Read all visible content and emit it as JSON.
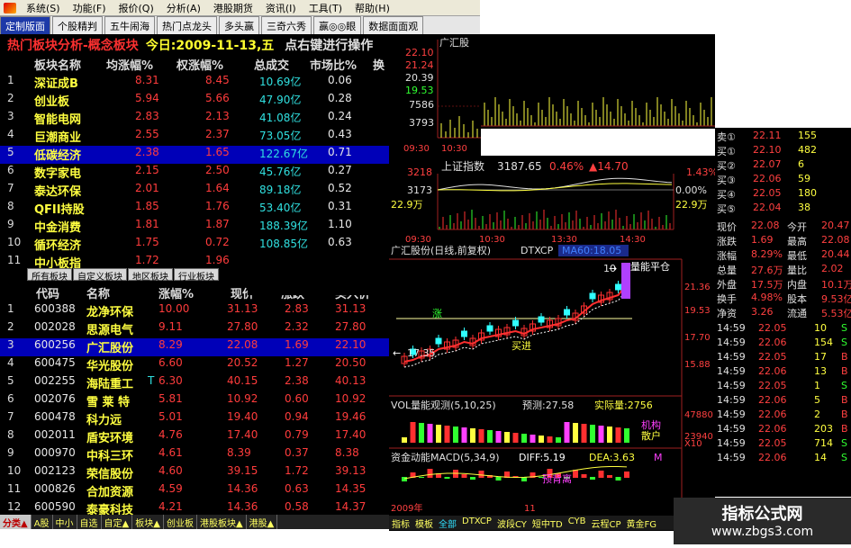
{
  "menubar": {
    "items": [
      "系统(S)",
      "功能(F)",
      "报价(Q)",
      "分析(A)",
      "港股期货",
      "资讯(I)",
      "工具(T)",
      "帮助(H)"
    ]
  },
  "tabs": {
    "items": [
      "定制版面",
      "个股精判",
      "五牛闹海",
      "热门点龙头",
      "多头赢",
      "三奇六秀",
      "赢◎◎眼",
      "数据面面观"
    ]
  },
  "top_panel": {
    "title": "热门板块分析-概念板块",
    "date": "今日:2009-11-13,五",
    "hint": "点右键进行操作",
    "headers": [
      "板块名称",
      "均涨幅%",
      "权涨幅%",
      "总成交",
      "市场比%",
      "换"
    ],
    "rows": [
      {
        "idx": "1",
        "name": "深证成B",
        "avg": "8.31",
        "wavg": "8.45",
        "vol": "10.69亿",
        "ratio": "0.06"
      },
      {
        "idx": "2",
        "name": "创业板",
        "avg": "5.94",
        "wavg": "5.66",
        "vol": "47.90亿",
        "ratio": "0.28"
      },
      {
        "idx": "3",
        "name": "智能电网",
        "avg": "2.83",
        "wavg": "2.13",
        "vol": "41.08亿",
        "ratio": "0.24"
      },
      {
        "idx": "4",
        "name": "巨潮商业",
        "avg": "2.55",
        "avg2": "",
        "wavg": "2.37",
        "vol": "73.05亿",
        "ratio": "0.43"
      },
      {
        "idx": "5",
        "name": "低碳经济",
        "avg": "2.38",
        "wavg": "1.65",
        "vol": "122.67亿",
        "ratio": "0.71"
      },
      {
        "idx": "6",
        "name": "数字家电",
        "avg": "2.15",
        "wavg": "2.50",
        "vol": "45.76亿",
        "ratio": "0.27"
      },
      {
        "idx": "7",
        "name": "泰达环保",
        "avg": "2.01",
        "wavg": "1.64",
        "vol": "89.18亿",
        "ratio": "0.52"
      },
      {
        "idx": "8",
        "name": "QFII持股",
        "avg": "1.85",
        "wavg": "1.76",
        "vol": "53.40亿",
        "ratio": "0.31"
      },
      {
        "idx": "9",
        "name": "中金消费",
        "avg": "1.81",
        "wavg": "1.87",
        "vol": "188.39亿",
        "ratio": "1.10"
      },
      {
        "idx": "10",
        "name": "循环经济",
        "avg": "1.75",
        "wavg": "0.72",
        "vol": "108.85亿",
        "ratio": "0.63"
      },
      {
        "idx": "11",
        "name": "中小板指",
        "avg": "1.72",
        "wavg": "1.96",
        "vol": "",
        "ratio": ""
      }
    ],
    "subtabs": [
      "所有板块",
      "自定义板块",
      "地区板块",
      "行业板块"
    ]
  },
  "bottom_panel": {
    "headers": [
      "代码",
      "名称",
      "涨幅%",
      "现价",
      "涨跌",
      "买入价"
    ],
    "rows": [
      {
        "idx": "1",
        "code": "600388",
        "name": "龙净环保",
        "chg": "10.00",
        "price": "31.13",
        "diff": "2.83",
        "buy": "31.13"
      },
      {
        "idx": "2",
        "code": "002028",
        "name": "思源电气",
        "chg": "9.11",
        "price": "27.80",
        "diff": "2.32",
        "buy": "27.80"
      },
      {
        "idx": "3",
        "code": "600256",
        "name": "广汇股份",
        "chg": "8.29",
        "price": "22.08",
        "diff": "1.69",
        "buy": "22.10"
      },
      {
        "idx": "4",
        "code": "600475",
        "name": "华光股份",
        "chg": "6.60",
        "price": "20.52",
        "diff": "1.27",
        "buy": "20.50"
      },
      {
        "idx": "5",
        "code": "002255",
        "name": "海陆重工",
        "mark": "T",
        "chg": "6.30",
        "price": "40.15",
        "diff": "2.38",
        "buy": "40.13"
      },
      {
        "idx": "6",
        "code": "002076",
        "name": "雪 莱 特",
        "chg": "5.81",
        "price": "10.92",
        "diff": "0.60",
        "buy": "10.92"
      },
      {
        "idx": "7",
        "code": "600478",
        "name": "科力远",
        "chg": "5.01",
        "price": "19.40",
        "diff": "0.94",
        "buy": "19.46"
      },
      {
        "idx": "8",
        "code": "002011",
        "name": "盾安环境",
        "chg": "4.76",
        "price": "17.40",
        "diff": "0.79",
        "buy": "17.40"
      },
      {
        "idx": "9",
        "code": "000970",
        "name": "中科三环",
        "chg": "4.61",
        "price": "8.39",
        "diff": "0.37",
        "buy": "8.38"
      },
      {
        "idx": "10",
        "code": "002123",
        "name": "荣信股份",
        "chg": "4.60",
        "price": "39.15",
        "diff": "1.72",
        "buy": "39.13"
      },
      {
        "idx": "11",
        "code": "000826",
        "name": "合加资源",
        "chg": "4.59",
        "price": "14.36",
        "diff": "0.63",
        "buy": "14.35"
      },
      {
        "idx": "12",
        "code": "600590",
        "name": "泰豪科技",
        "chg": "4.21",
        "price": "14.36",
        "diff": "0.58",
        "buy": "14.37"
      }
    ],
    "tabs": [
      "分类▲",
      "A股",
      "中小",
      "自选",
      "自定▲",
      "板块▲",
      "创业板",
      "港股板块▲",
      "港股▲"
    ]
  },
  "intraday": {
    "name": "广汇股",
    "yticks": [
      "22.10",
      "21.24",
      "20.39",
      "19.53"
    ],
    "vticks": [
      "7586",
      "3793"
    ],
    "times": [
      "09:30",
      "10:30",
      "13:30",
      "14:30"
    ]
  },
  "index_panel": {
    "name": "上证指数",
    "value": "3187.65",
    "pct": "0.46%",
    "chg": "▲14.70",
    "left_ticks": [
      "3218",
      "3173",
      "22.9万"
    ],
    "right_ticks": [
      "1.43%",
      "0.00%",
      "22.9万"
    ],
    "times": [
      "09:30",
      "10:30",
      "13:30",
      "14:30"
    ]
  },
  "kline": {
    "title": "广汇股份(日线,前复权)",
    "indicator": "DTXCP",
    "ma": "MA60:18.05",
    "ticks": [
      "22.10",
      "21.36",
      "19.53",
      "17.70",
      "15.88"
    ],
    "annot_low": "17.35",
    "annot_high": "10",
    "annot_buy": "买进",
    "annot_level": "量能平仓",
    "vol_title": "VOL量能观测(5,10,25)",
    "vol_pred": "预测:27.58",
    "vol_actual": "实际量:2756",
    "vol_ticks": [
      "47880",
      "23940"
    ],
    "vol_note1": "机构",
    "vol_note2": "散户",
    "vol_x": "X10",
    "macd_title": "资金动能MACD(5,34,9)",
    "macd_diff": "DIFF:5.19",
    "macd_dea": "DEA:3.63",
    "macd_m": "M",
    "macd_note": "预背离",
    "year": "2009年",
    "month": "11"
  },
  "order_book": {
    "rows": [
      {
        "label": "卖①",
        "price": "22.11",
        "vol": "155"
      },
      {
        "label": "买①",
        "price": "22.10",
        "vol": "482"
      },
      {
        "label": "买②",
        "price": "22.07",
        "vol": "6"
      },
      {
        "label": "买③",
        "price": "22.06",
        "vol": "59"
      },
      {
        "label": "买④",
        "price": "22.05",
        "vol": "180"
      },
      {
        "label": "买⑤",
        "price": "22.04",
        "vol": "38"
      }
    ],
    "stats": [
      {
        "k1": "现价",
        "v1": "22.08",
        "k2": "今开",
        "v2": "20.47"
      },
      {
        "k1": "涨跌",
        "v1": "1.69",
        "k2": "最高",
        "v2": "22.08"
      },
      {
        "k1": "涨幅",
        "v1": "8.29%",
        "k2": "最低",
        "v2": "20.44"
      },
      {
        "k1": "总量",
        "v1": "27.6万",
        "k2": "量比",
        "v2": "2.02"
      },
      {
        "k1": "外盘",
        "v1": "17.5万",
        "k2": "内盘",
        "v2": "10.1万"
      },
      {
        "k1": "换手",
        "v1": "4.98%",
        "k2": "股本",
        "v2": "9.53亿"
      },
      {
        "k1": "净资",
        "v1": "3.26",
        "k2": "流通",
        "v2": "5.53亿"
      }
    ],
    "ticks": [
      {
        "t": "14:59",
        "p": "22.05",
        "v": "10",
        "s": "S"
      },
      {
        "t": "14:59",
        "p": "22.06",
        "v": "154",
        "s": "S"
      },
      {
        "t": "14:59",
        "p": "22.05",
        "v": "17",
        "s": "B"
      },
      {
        "t": "14:59",
        "p": "22.06",
        "v": "13",
        "s": "B"
      },
      {
        "t": "14:59",
        "p": "22.05",
        "v": "1",
        "s": "S"
      },
      {
        "t": "14:59",
        "p": "22.06",
        "v": "5",
        "s": "B"
      },
      {
        "t": "14:59",
        "p": "22.06",
        "v": "2",
        "s": "B"
      },
      {
        "t": "14:59",
        "p": "22.06",
        "v": "203",
        "s": "B"
      },
      {
        "t": "14:59",
        "p": "22.05",
        "v": "714",
        "s": "S"
      },
      {
        "t": "14:59",
        "p": "22.06",
        "v": "14",
        "s": "S"
      }
    ]
  },
  "bottom_kbar": {
    "items": [
      "指标",
      "模板",
      "全部",
      "DTXCP",
      "波段CY",
      "短中TD",
      "CYB",
      "云程CP",
      "黄金FG"
    ]
  },
  "watermark": {
    "line1": "指标公式网",
    "line2": "www.zbgs3.com"
  }
}
